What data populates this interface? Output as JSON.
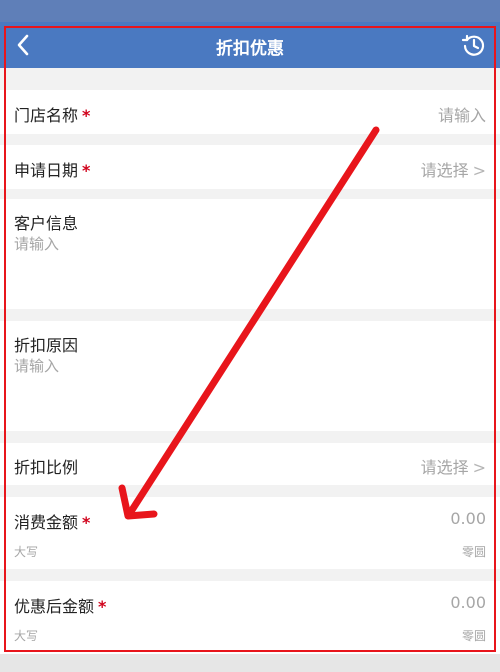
{
  "header": {
    "title": "折扣优惠",
    "back_icon": "chevron-left-icon",
    "history_icon": "history-clock-icon"
  },
  "form": {
    "store_name": {
      "label": "门店名称",
      "required_mark": "*",
      "placeholder": "请输入"
    },
    "apply_date": {
      "label": "申请日期",
      "required_mark": "*",
      "placeholder": "请选择",
      "chevron": ">"
    },
    "customer_info": {
      "label": "客户信息",
      "placeholder": "请输入"
    },
    "discount_reason": {
      "label": "折扣原因",
      "placeholder": "请输入"
    },
    "discount_ratio": {
      "label": "折扣比例",
      "placeholder": "请选择",
      "chevron": ">"
    },
    "spend_amount": {
      "label": "消费金额",
      "required_mark": "*",
      "value": "0.00",
      "uppercase_label": "大写",
      "uppercase_value": "零圆"
    },
    "after_discount_amount": {
      "label": "优惠后金额",
      "required_mark": "*",
      "value": "0.00",
      "uppercase_label": "大写",
      "uppercase_value": "零圆"
    }
  },
  "colors": {
    "header_bg": "#4a79c1",
    "required": "#d0021b",
    "annotation": "#e8151b"
  }
}
